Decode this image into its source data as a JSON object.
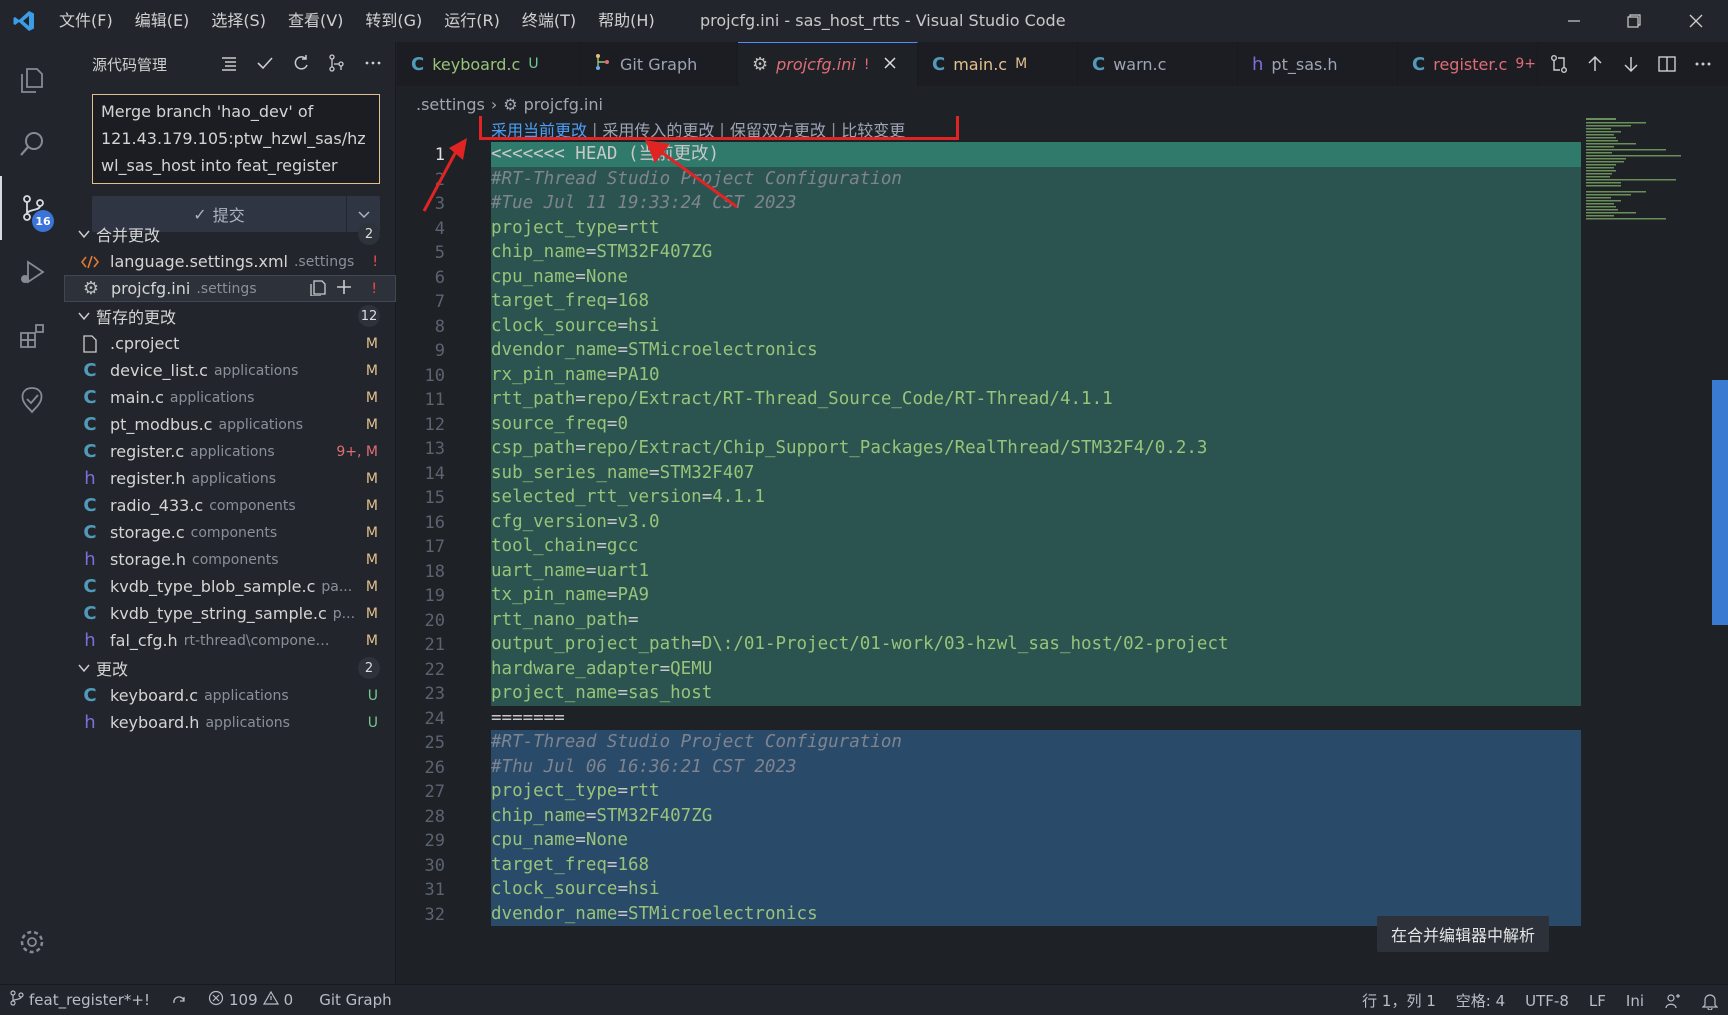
{
  "window": {
    "menus": [
      "文件(F)",
      "编辑(E)",
      "选择(S)",
      "查看(V)",
      "转到(G)",
      "运行(R)",
      "终端(T)",
      "帮助(H)"
    ],
    "title": "projcfg.ini - sas_host_rtts - Visual Studio Code"
  },
  "activitybar": {
    "scm_badge": "16"
  },
  "sidebar": {
    "title": "源代码管理",
    "commit_message": "Merge branch 'hao_dev' of\n121.43.179.105:ptw_hzwl_sas/hz\nwl_sas_host into feat_register",
    "commit_button": "提交",
    "groups": [
      {
        "label": "合并更改",
        "count": "2",
        "files": [
          {
            "name": "language.settings.xml",
            "dir": ".settings",
            "status": "!",
            "icon": "xml-icon"
          },
          {
            "name": "projcfg.ini",
            "dir": ".settings",
            "status": "!",
            "icon": "gear-icon"
          }
        ]
      },
      {
        "label": "暂存的更改",
        "count": "12",
        "files": [
          {
            "name": ".cproject",
            "dir": "",
            "status": "M",
            "icon": "file-icon"
          },
          {
            "name": "device_list.c",
            "dir": "applications",
            "status": "M",
            "icon": "c-icon"
          },
          {
            "name": "main.c",
            "dir": "applications",
            "status": "M",
            "icon": "c-icon"
          },
          {
            "name": "pt_modbus.c",
            "dir": "applications",
            "status": "M",
            "icon": "c-icon"
          },
          {
            "name": "register.c",
            "dir": "applications",
            "status": "9+, M",
            "icon": "c-icon"
          },
          {
            "name": "register.h",
            "dir": "applications",
            "status": "M",
            "icon": "h-icon"
          },
          {
            "name": "radio_433.c",
            "dir": "components",
            "status": "M",
            "icon": "c-icon"
          },
          {
            "name": "storage.c",
            "dir": "components",
            "status": "M",
            "icon": "c-icon"
          },
          {
            "name": "storage.h",
            "dir": "components",
            "status": "M",
            "icon": "h-icon"
          },
          {
            "name": "kvdb_type_blob_sample.c",
            "dir": "pa...",
            "status": "M",
            "icon": "c-icon"
          },
          {
            "name": "kvdb_type_string_sample.c",
            "dir": "p...",
            "status": "M",
            "icon": "c-icon"
          },
          {
            "name": "fal_cfg.h",
            "dir": "rt-thread\\component...",
            "status": "M",
            "icon": "h-icon"
          }
        ]
      },
      {
        "label": "更改",
        "count": "2",
        "files": [
          {
            "name": "keyboard.c",
            "dir": "applications",
            "status": "U",
            "icon": "c-icon"
          },
          {
            "name": "keyboard.h",
            "dir": "applications",
            "status": "U",
            "icon": "h-icon"
          }
        ]
      }
    ]
  },
  "tabs": [
    {
      "name": "keyboard.c",
      "status": "U",
      "icon": "c-icon",
      "color": "#98c379",
      "stat_color": "#73c991"
    },
    {
      "name": "Git Graph",
      "status": "",
      "icon": "git-graph-icon",
      "color": "#9da5b4",
      "stat_color": ""
    },
    {
      "name": "projcfg.ini",
      "status": "!",
      "icon": "gear-icon",
      "color": "#e06c75",
      "stat_color": "#e06c75",
      "active": true
    },
    {
      "name": "main.c",
      "status": "M",
      "icon": "c-icon",
      "color": "#e2c08d",
      "stat_color": "#e2c08d"
    },
    {
      "name": "warn.c",
      "status": "",
      "icon": "c-icon",
      "color": "#9da5b4",
      "stat_color": ""
    },
    {
      "name": "pt_sas.h",
      "status": "",
      "icon": "h-icon",
      "color": "#9da5b4",
      "stat_color": ""
    },
    {
      "name": "register.c",
      "status": "9+",
      "icon": "c-icon",
      "color": "#e06c75",
      "stat_color": "#e06c75"
    }
  ],
  "breadcrumb": [
    ".settings",
    "projcfg.ini"
  ],
  "codelens": [
    "采用当前更改",
    "采用传入的更改",
    "保留双方更改",
    "比较变更"
  ],
  "code": [
    {
      "n": "1",
      "t": "<<<<<<< HEAD (当前更改)",
      "kind": "marker",
      "bg": "head"
    },
    {
      "n": "2",
      "t": "#RT-Thread Studio Project Configuration",
      "kind": "comment",
      "bg": "cur"
    },
    {
      "n": "3",
      "t": "#Tue Jul 11 19:33:24 CST 2023",
      "kind": "comment",
      "bg": "cur"
    },
    {
      "n": "4",
      "k": "project_type",
      "v": "rtt",
      "bg": "cur"
    },
    {
      "n": "5",
      "k": "chip_name",
      "v": "STM32F407ZG",
      "bg": "cur"
    },
    {
      "n": "6",
      "k": "cpu_name",
      "v": "None",
      "bg": "cur"
    },
    {
      "n": "7",
      "k": "target_freq",
      "v": "168",
      "bg": "cur"
    },
    {
      "n": "8",
      "k": "clock_source",
      "v": "hsi",
      "bg": "cur"
    },
    {
      "n": "9",
      "k": "dvendor_name",
      "v": "STMicroelectronics",
      "bg": "cur"
    },
    {
      "n": "10",
      "k": "rx_pin_name",
      "v": "PA10",
      "bg": "cur"
    },
    {
      "n": "11",
      "k": "rtt_path",
      "v": "repo/Extract/RT-Thread_Source_Code/RT-Thread/4.1.1",
      "bg": "cur"
    },
    {
      "n": "12",
      "k": "source_freq",
      "v": "0",
      "bg": "cur"
    },
    {
      "n": "13",
      "k": "csp_path",
      "v": "repo/Extract/Chip_Support_Packages/RealThread/STM32F4/0.2.3",
      "bg": "cur"
    },
    {
      "n": "14",
      "k": "sub_series_name",
      "v": "STM32F407",
      "bg": "cur"
    },
    {
      "n": "15",
      "k": "selected_rtt_version",
      "v": "4.1.1",
      "bg": "cur"
    },
    {
      "n": "16",
      "k": "cfg_version",
      "v": "v3.0",
      "bg": "cur"
    },
    {
      "n": "17",
      "k": "tool_chain",
      "v": "gcc",
      "bg": "cur"
    },
    {
      "n": "18",
      "k": "uart_name",
      "v": "uart1",
      "bg": "cur"
    },
    {
      "n": "19",
      "k": "tx_pin_name",
      "v": "PA9",
      "bg": "cur"
    },
    {
      "n": "20",
      "k": "rtt_nano_path",
      "v": "",
      "bg": "cur"
    },
    {
      "n": "21",
      "k": "output_project_path",
      "v": "D\\:/01-Project/01-work/03-hzwl_sas_host/02-project",
      "bg": "cur"
    },
    {
      "n": "22",
      "k": "hardware_adapter",
      "v": "QEMU",
      "bg": "cur"
    },
    {
      "n": "23",
      "k": "project_name",
      "v": "sas_host",
      "bg": "cur"
    },
    {
      "n": "24",
      "t": "=======",
      "kind": "marker",
      "bg": "none"
    },
    {
      "n": "25",
      "t": "#RT-Thread Studio Project Configuration",
      "kind": "comment",
      "bg": "inc"
    },
    {
      "n": "26",
      "t": "#Thu Jul 06 16:36:21 CST 2023",
      "kind": "comment",
      "bg": "inc"
    },
    {
      "n": "27",
      "k": "project_type",
      "v": "rtt",
      "bg": "inc"
    },
    {
      "n": "28",
      "k": "chip_name",
      "v": "STM32F407ZG",
      "bg": "inc"
    },
    {
      "n": "29",
      "k": "cpu_name",
      "v": "None",
      "bg": "inc"
    },
    {
      "n": "30",
      "k": "target_freq",
      "v": "168",
      "bg": "inc"
    },
    {
      "n": "31",
      "k": "clock_source",
      "v": "hsi",
      "bg": "inc"
    },
    {
      "n": "32",
      "k": "dvendor_name",
      "v": "STMicroelectronics",
      "bg": "inc"
    }
  ],
  "resolve_button": "在合并编辑器中解析",
  "statusbar": {
    "branch": "feat_register*+!",
    "errors": "109",
    "warnings": "0",
    "git_graph": "Git Graph",
    "position": "行 1，列 1",
    "spaces": "空格: 4",
    "encoding": "UTF-8",
    "eol": "LF",
    "language": "Ini"
  }
}
